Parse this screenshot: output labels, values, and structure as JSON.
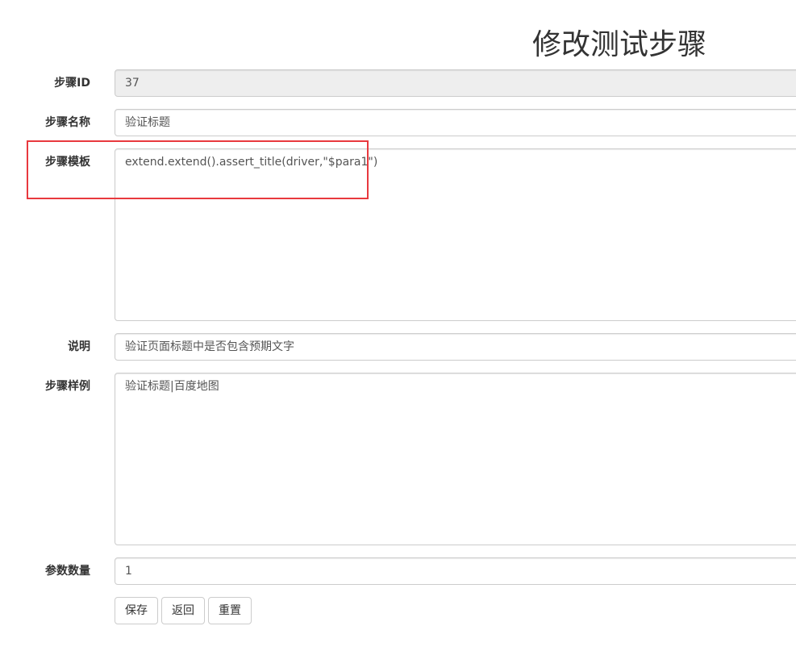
{
  "page": {
    "title": "修改测试步骤"
  },
  "form": {
    "step_id": {
      "label": "步骤ID",
      "value": "37"
    },
    "step_name": {
      "label": "步骤名称",
      "value": "验证标题"
    },
    "step_template": {
      "label": "步骤模板",
      "value": "extend.extend().assert_title(driver,\"$para1\")"
    },
    "description": {
      "label": "说明",
      "value": "验证页面标题中是否包含预期文字"
    },
    "step_example": {
      "label": "步骤样例",
      "value": "验证标题|百度地图"
    },
    "param_count": {
      "label": "参数数量",
      "value": "1"
    }
  },
  "actions": {
    "save_label": "保存",
    "back_label": "返回",
    "reset_label": "重置"
  },
  "colors": {
    "highlight_border": "#e8393e",
    "readonly_bg": "#eeeeee",
    "input_border": "#cccccc"
  }
}
